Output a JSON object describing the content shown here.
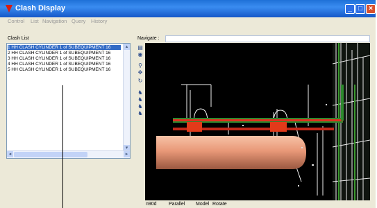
{
  "window": {
    "title": "Clash Display"
  },
  "menu": [
    "Control",
    "List",
    "Navigation",
    "Query",
    "History"
  ],
  "clash_list": {
    "label": "Clash List",
    "rows": [
      "1  HH CLASH CYLINDER 1 of SUBEQUIPMENT 16",
      "2  HH CLASH CYLINDER 1 of SUBEQUIPMENT 16",
      "3  HH CLASH CYLINDER 1 of SUBEQUIPMENT 16",
      "4  HH CLASH CYLINDER 1 of SUBEQUIPMENT 16",
      "5  HH CLASH CYLINDER 1 of SUBEQUIPMENT 16"
    ]
  },
  "navigate": {
    "label": "Navigate :",
    "value": ""
  },
  "toolbar": [
    "view-icon",
    "globe-icon",
    "zoom-icon",
    "pan-icon",
    "rotate-icon",
    "walk-icon",
    "walk-icon",
    "walk-icon",
    "walk-icon"
  ],
  "status": {
    "view": "n90d",
    "projection": "Parallel",
    "mode": "Model",
    "action": "Rotate"
  },
  "colors": {
    "titlebar": "#1f71d8",
    "selection": "#316ac5",
    "viewport": "#000000",
    "pipe_highlight": "#e03020",
    "vessel": "#f0a888"
  }
}
